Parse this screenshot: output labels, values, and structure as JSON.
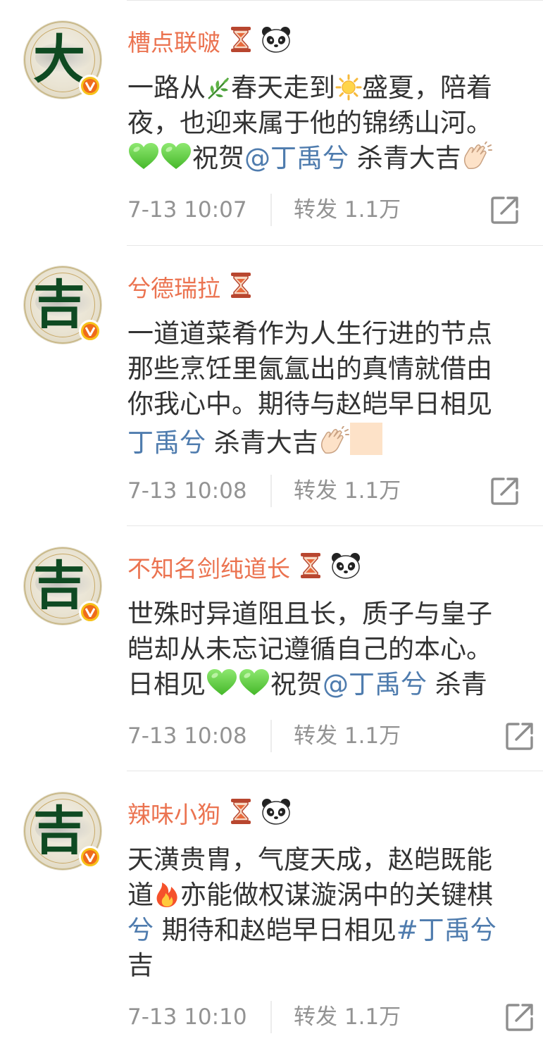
{
  "posts": [
    {
      "avatar_char": "大",
      "username": "槽点联啵",
      "badges": [
        "hourglass-badge-icon",
        "panda-badge-icon"
      ],
      "lines": [
        [
          {
            "t": "一路从"
          },
          {
            "e": "herb-emoji-icon"
          },
          {
            "t": "春天走到"
          },
          {
            "e": "sun-emoji-icon"
          },
          {
            "t": "盛夏，陪着"
          }
        ],
        [
          {
            "t": "夜，也迎来属于他的锦绣山河。"
          }
        ],
        [
          {
            "e": "green-heart-emoji-icon"
          },
          {
            "e": "green-heart-emoji-icon"
          },
          {
            "t": "祝贺"
          },
          {
            "m": "@丁禹兮"
          },
          {
            "t": " 杀青大吉"
          },
          {
            "e": "clapping-hands-emoji-icon"
          }
        ]
      ],
      "timestamp": "7-13 10:07",
      "repost": "转发 1.1万"
    },
    {
      "avatar_char": "吉",
      "username": "兮德瑞拉",
      "badges": [
        "hourglass-badge-icon"
      ],
      "lines": [
        [
          {
            "t": "一道道菜肴作为人生行进的节点"
          }
        ],
        [
          {
            "t": "那些烹饪里氤氲出的真情就借由"
          }
        ],
        [
          {
            "t": "你我心中。期待与赵皑早日相见"
          }
        ],
        [
          {
            "m": "丁禹兮"
          },
          {
            "t": " 杀青大吉"
          },
          {
            "e": "clapping-hands-emoji-icon"
          },
          {
            "e": "skin-tone-modifier-icon"
          }
        ]
      ],
      "timestamp": "7-13 10:08",
      "repost": "转发 1.1万"
    },
    {
      "avatar_char": "吉",
      "username": "不知名剑纯道长",
      "badges": [
        "hourglass-badge-icon",
        "panda-badge-icon"
      ],
      "lines": [
        [
          {
            "t": "世殊时异道阻且长，质子与皇子"
          }
        ],
        [
          {
            "t": "皑却从未忘记遵循自己的本心。"
          }
        ],
        [
          {
            "t": "日相见"
          },
          {
            "e": "green-heart-emoji-icon"
          },
          {
            "e": "green-heart-emoji-icon"
          },
          {
            "t": "祝贺"
          },
          {
            "m": "@丁禹兮"
          },
          {
            "t": " 杀青"
          }
        ]
      ],
      "timestamp": "7-13 10:08",
      "repost": "转发 1.1万"
    },
    {
      "avatar_char": "吉",
      "username": "辣味小狗",
      "badges": [
        "hourglass-badge-icon",
        "panda-badge-icon"
      ],
      "lines": [
        [
          {
            "t": "天潢贵胄，气度天成，赵皑既能"
          }
        ],
        [
          {
            "t": "道"
          },
          {
            "e": "fire-emoji-icon"
          },
          {
            "t": "亦能做权谋漩涡中的关键棋"
          }
        ],
        [
          {
            "m": "兮"
          },
          {
            "t": "  期待和赵皑早日相见"
          },
          {
            "m": "#丁禹兮"
          }
        ],
        [
          {
            "t": "吉"
          }
        ]
      ],
      "timestamp": "7-13 10:10",
      "repost": "转发 1.1万"
    }
  ]
}
